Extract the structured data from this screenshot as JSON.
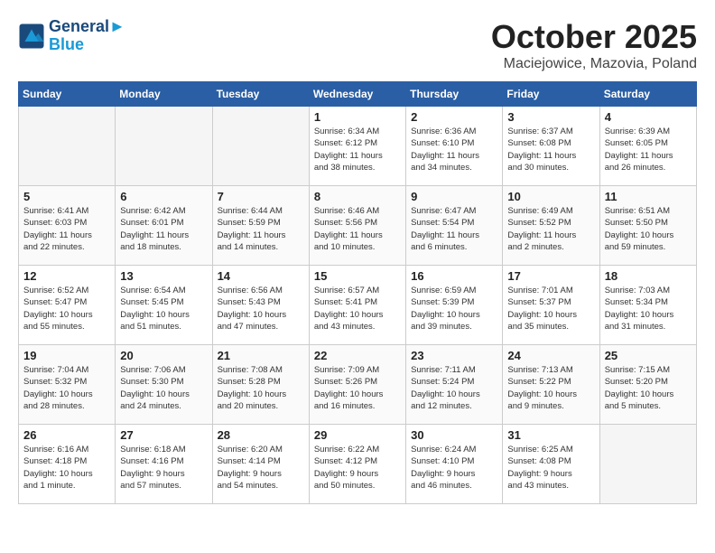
{
  "logo": {
    "line1": "General",
    "line2": "Blue"
  },
  "title": "October 2025",
  "subtitle": "Maciejowice, Mazovia, Poland",
  "weekdays": [
    "Sunday",
    "Monday",
    "Tuesday",
    "Wednesday",
    "Thursday",
    "Friday",
    "Saturday"
  ],
  "weeks": [
    [
      {
        "day": "",
        "info": ""
      },
      {
        "day": "",
        "info": ""
      },
      {
        "day": "",
        "info": ""
      },
      {
        "day": "1",
        "info": "Sunrise: 6:34 AM\nSunset: 6:12 PM\nDaylight: 11 hours\nand 38 minutes."
      },
      {
        "day": "2",
        "info": "Sunrise: 6:36 AM\nSunset: 6:10 PM\nDaylight: 11 hours\nand 34 minutes."
      },
      {
        "day": "3",
        "info": "Sunrise: 6:37 AM\nSunset: 6:08 PM\nDaylight: 11 hours\nand 30 minutes."
      },
      {
        "day": "4",
        "info": "Sunrise: 6:39 AM\nSunset: 6:05 PM\nDaylight: 11 hours\nand 26 minutes."
      }
    ],
    [
      {
        "day": "5",
        "info": "Sunrise: 6:41 AM\nSunset: 6:03 PM\nDaylight: 11 hours\nand 22 minutes."
      },
      {
        "day": "6",
        "info": "Sunrise: 6:42 AM\nSunset: 6:01 PM\nDaylight: 11 hours\nand 18 minutes."
      },
      {
        "day": "7",
        "info": "Sunrise: 6:44 AM\nSunset: 5:59 PM\nDaylight: 11 hours\nand 14 minutes."
      },
      {
        "day": "8",
        "info": "Sunrise: 6:46 AM\nSunset: 5:56 PM\nDaylight: 11 hours\nand 10 minutes."
      },
      {
        "day": "9",
        "info": "Sunrise: 6:47 AM\nSunset: 5:54 PM\nDaylight: 11 hours\nand 6 minutes."
      },
      {
        "day": "10",
        "info": "Sunrise: 6:49 AM\nSunset: 5:52 PM\nDaylight: 11 hours\nand 2 minutes."
      },
      {
        "day": "11",
        "info": "Sunrise: 6:51 AM\nSunset: 5:50 PM\nDaylight: 10 hours\nand 59 minutes."
      }
    ],
    [
      {
        "day": "12",
        "info": "Sunrise: 6:52 AM\nSunset: 5:47 PM\nDaylight: 10 hours\nand 55 minutes."
      },
      {
        "day": "13",
        "info": "Sunrise: 6:54 AM\nSunset: 5:45 PM\nDaylight: 10 hours\nand 51 minutes."
      },
      {
        "day": "14",
        "info": "Sunrise: 6:56 AM\nSunset: 5:43 PM\nDaylight: 10 hours\nand 47 minutes."
      },
      {
        "day": "15",
        "info": "Sunrise: 6:57 AM\nSunset: 5:41 PM\nDaylight: 10 hours\nand 43 minutes."
      },
      {
        "day": "16",
        "info": "Sunrise: 6:59 AM\nSunset: 5:39 PM\nDaylight: 10 hours\nand 39 minutes."
      },
      {
        "day": "17",
        "info": "Sunrise: 7:01 AM\nSunset: 5:37 PM\nDaylight: 10 hours\nand 35 minutes."
      },
      {
        "day": "18",
        "info": "Sunrise: 7:03 AM\nSunset: 5:34 PM\nDaylight: 10 hours\nand 31 minutes."
      }
    ],
    [
      {
        "day": "19",
        "info": "Sunrise: 7:04 AM\nSunset: 5:32 PM\nDaylight: 10 hours\nand 28 minutes."
      },
      {
        "day": "20",
        "info": "Sunrise: 7:06 AM\nSunset: 5:30 PM\nDaylight: 10 hours\nand 24 minutes."
      },
      {
        "day": "21",
        "info": "Sunrise: 7:08 AM\nSunset: 5:28 PM\nDaylight: 10 hours\nand 20 minutes."
      },
      {
        "day": "22",
        "info": "Sunrise: 7:09 AM\nSunset: 5:26 PM\nDaylight: 10 hours\nand 16 minutes."
      },
      {
        "day": "23",
        "info": "Sunrise: 7:11 AM\nSunset: 5:24 PM\nDaylight: 10 hours\nand 12 minutes."
      },
      {
        "day": "24",
        "info": "Sunrise: 7:13 AM\nSunset: 5:22 PM\nDaylight: 10 hours\nand 9 minutes."
      },
      {
        "day": "25",
        "info": "Sunrise: 7:15 AM\nSunset: 5:20 PM\nDaylight: 10 hours\nand 5 minutes."
      }
    ],
    [
      {
        "day": "26",
        "info": "Sunrise: 6:16 AM\nSunset: 4:18 PM\nDaylight: 10 hours\nand 1 minute."
      },
      {
        "day": "27",
        "info": "Sunrise: 6:18 AM\nSunset: 4:16 PM\nDaylight: 9 hours\nand 57 minutes."
      },
      {
        "day": "28",
        "info": "Sunrise: 6:20 AM\nSunset: 4:14 PM\nDaylight: 9 hours\nand 54 minutes."
      },
      {
        "day": "29",
        "info": "Sunrise: 6:22 AM\nSunset: 4:12 PM\nDaylight: 9 hours\nand 50 minutes."
      },
      {
        "day": "30",
        "info": "Sunrise: 6:24 AM\nSunset: 4:10 PM\nDaylight: 9 hours\nand 46 minutes."
      },
      {
        "day": "31",
        "info": "Sunrise: 6:25 AM\nSunset: 4:08 PM\nDaylight: 9 hours\nand 43 minutes."
      },
      {
        "day": "",
        "info": ""
      }
    ]
  ]
}
